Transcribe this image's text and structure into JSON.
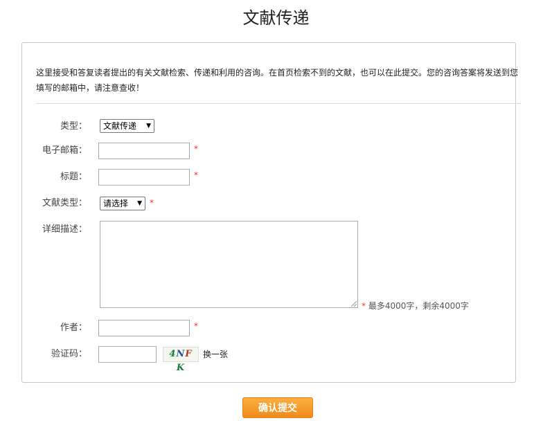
{
  "page": {
    "title": "文献传递"
  },
  "intro": {
    "text": "这里接受和答复读者提出的有关文献检索、传递和利用的咨询。在首页检索不到的文献，也可以在此提交。您的咨询答案将发送到您填写的邮箱中，请注意查收！"
  },
  "form": {
    "type": {
      "label": "类型：",
      "selected": "文献传递"
    },
    "email": {
      "label": "电子邮箱：",
      "value": "",
      "required_mark": "*"
    },
    "subject": {
      "label": "标题：",
      "value": "",
      "required_mark": "*"
    },
    "doc_type": {
      "label": "文献类型：",
      "selected": "请选择",
      "required_mark": "*"
    },
    "description": {
      "label": "详细描述：",
      "value": "",
      "required_mark": "*",
      "counter": "最多4000字，剩余4000字"
    },
    "author": {
      "label": "作者：",
      "value": "",
      "required_mark": "*"
    },
    "captcha": {
      "label": "验证码：",
      "value": "",
      "image_text": [
        "4",
        "N",
        "F",
        "K"
      ],
      "refresh_label": "换一张"
    }
  },
  "actions": {
    "submit_label": "确认提交"
  },
  "colors": {
    "accent": "#f08a1c",
    "required": "#e33333",
    "border": "#c8c8c8"
  }
}
